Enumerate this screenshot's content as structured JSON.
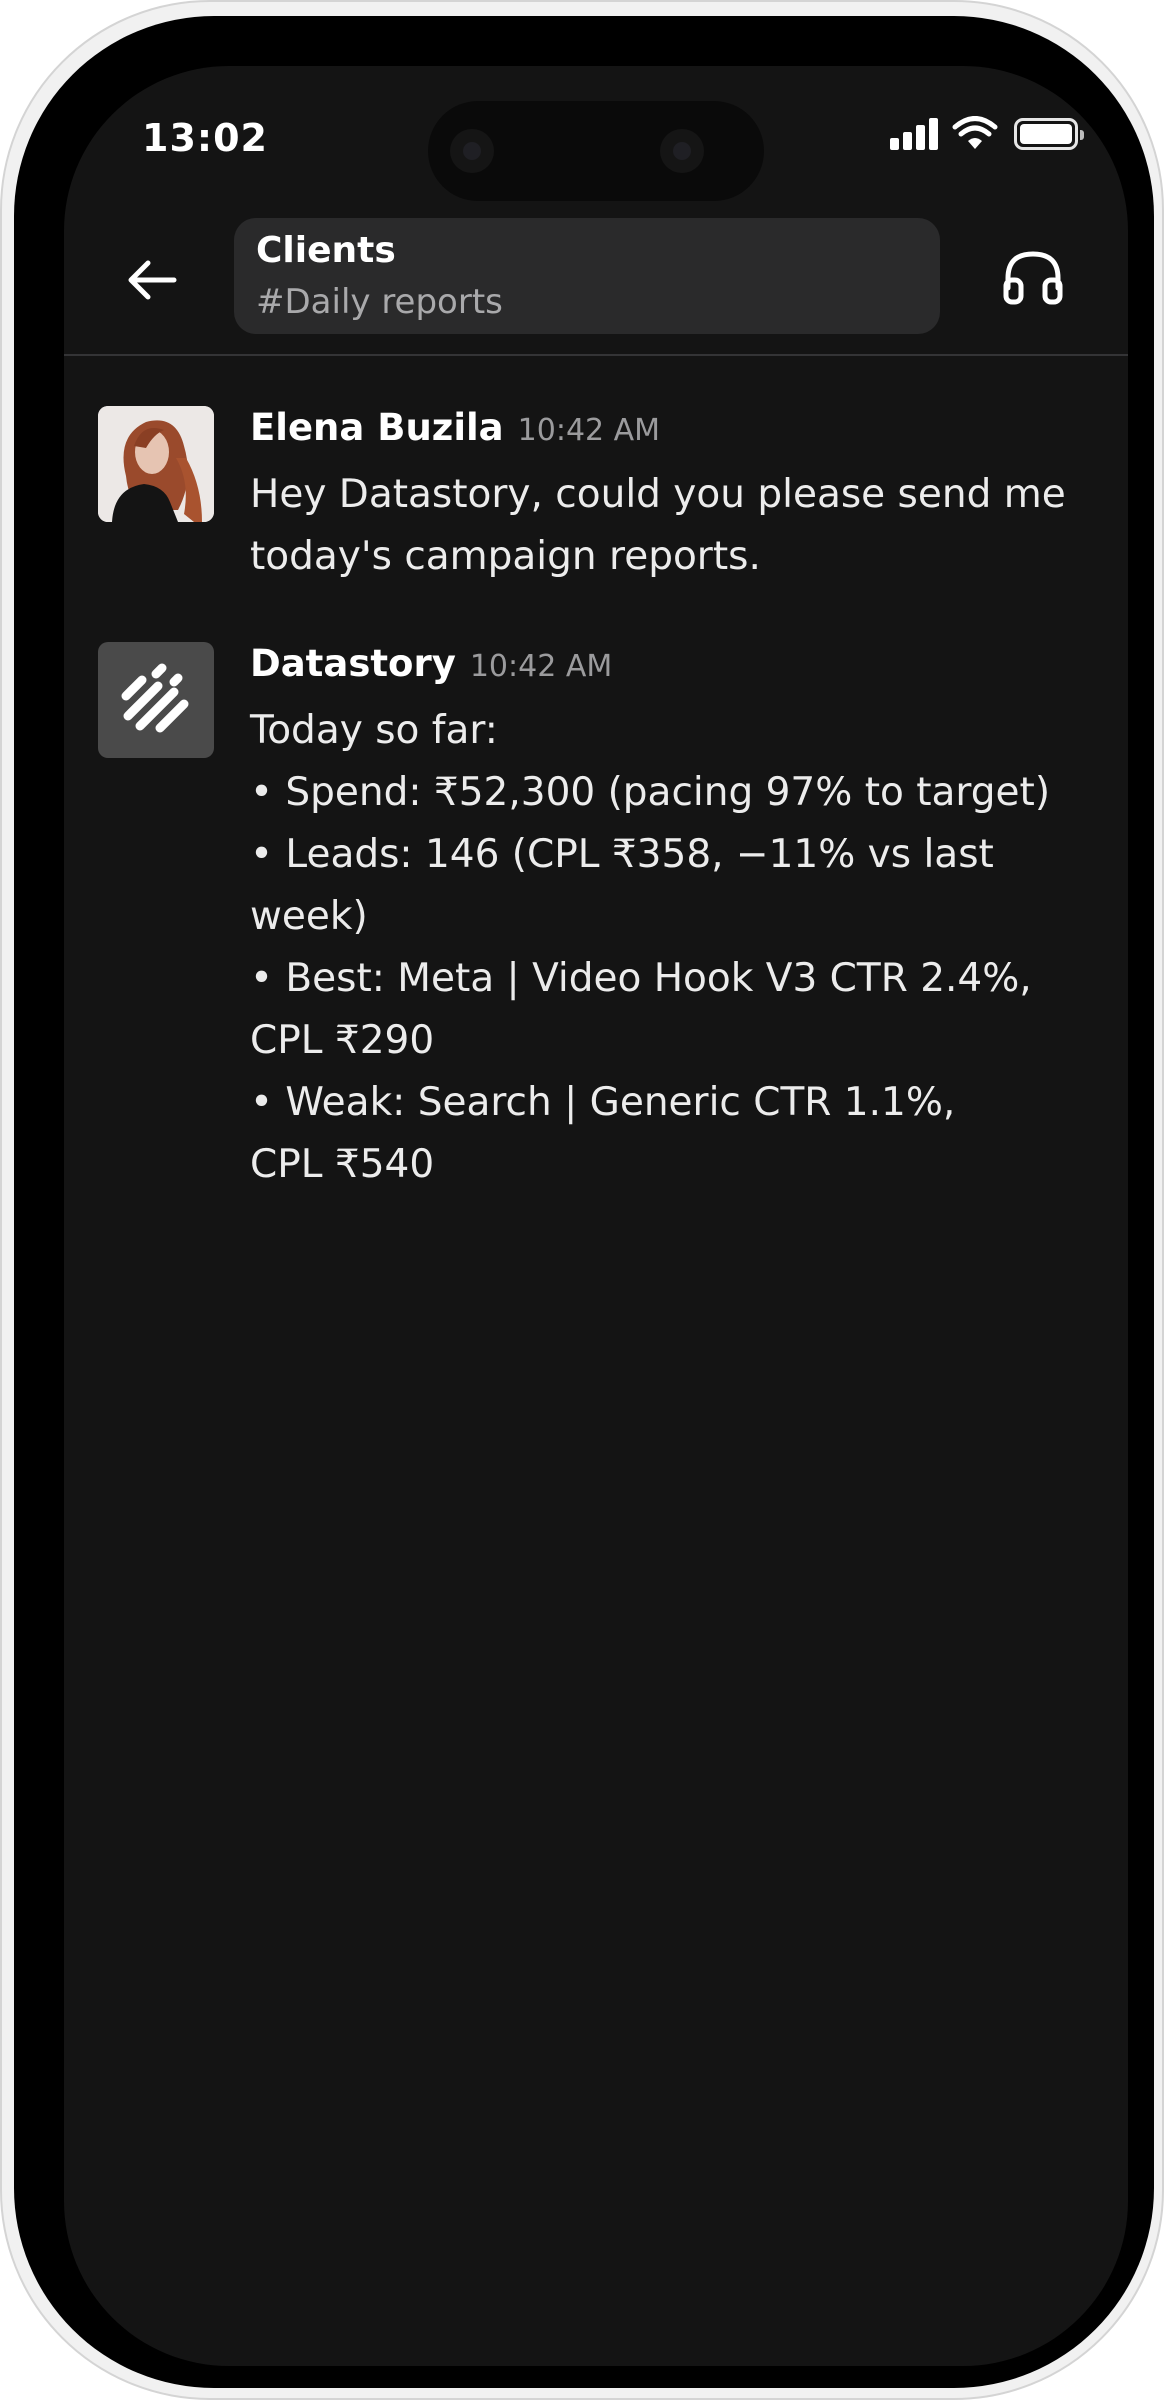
{
  "status_bar": {
    "time": "13:02",
    "icons": [
      "cellular-signal-icon",
      "wifi-icon",
      "battery-icon"
    ]
  },
  "header": {
    "back_icon": "arrow-left-icon",
    "channel_title": "Clients",
    "channel_subtitle": "#Daily reports",
    "huddle_icon": "headphones-icon"
  },
  "messages": [
    {
      "author": "Elena Buzila",
      "time": "10:42 AM",
      "lines": [
        "Hey Datastory, could you please send me",
        "today's campaign reports."
      ]
    },
    {
      "author": "Datastory",
      "time": "10:42 AM",
      "lines": [
        "Today so far:",
        "• Spend: ₹52,300 (pacing 97% to target)",
        "• Leads: 146 (CPL ₹358, −11% vs last",
        "week)",
        "• Best: Meta | Video Hook V3 CTR 2.4%,",
        "CPL ₹290",
        "• Weak: Search | Generic CTR 1.1%,",
        "CPL ₹540"
      ]
    }
  ],
  "colors": {
    "screen_background": "#141414",
    "channel_box": "#2a2a2b",
    "text_primary": "#ffffff",
    "text_secondary": "#9b9b9d"
  }
}
